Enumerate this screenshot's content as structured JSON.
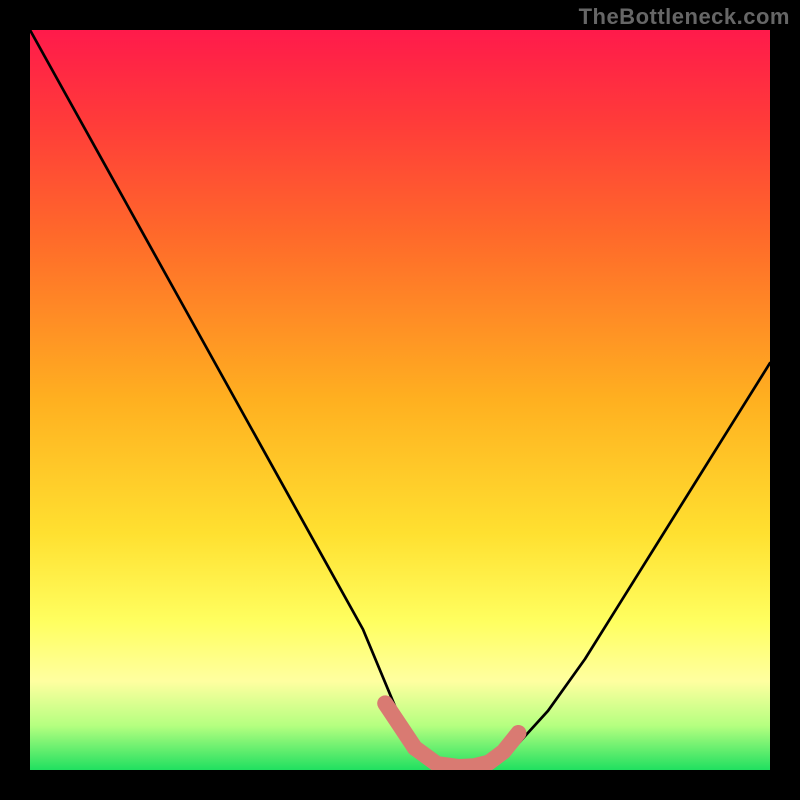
{
  "watermark": "TheBottleneck.com",
  "chart_data": {
    "type": "line",
    "title": "",
    "xlabel": "",
    "ylabel": "",
    "xlim": [
      0,
      100
    ],
    "ylim": [
      0,
      100
    ],
    "grid": false,
    "series": [
      {
        "name": "bottleneck-curve",
        "x": [
          0,
          5,
          10,
          15,
          20,
          25,
          30,
          35,
          40,
          45,
          50,
          52,
          55,
          58,
          60,
          62,
          65,
          70,
          75,
          80,
          85,
          90,
          95,
          100
        ],
        "y": [
          100,
          91,
          82,
          73,
          64,
          55,
          46,
          37,
          28,
          19,
          7,
          3,
          0.5,
          0,
          0,
          0.5,
          2.5,
          8,
          15,
          23,
          31,
          39,
          47,
          55
        ]
      }
    ],
    "markers": {
      "name": "highlight-band",
      "x": [
        48,
        50,
        52,
        55,
        58,
        60,
        62,
        64,
        66
      ],
      "y": [
        9,
        6,
        3,
        0.8,
        0.4,
        0.5,
        1,
        2.5,
        5
      ]
    },
    "colors": {
      "gradient_top": "#ff1a4b",
      "gradient_mid": "#ffe030",
      "gradient_bottom": "#20e060",
      "curve": "#000000",
      "marker": "#d97a72",
      "background": "#000000"
    }
  }
}
